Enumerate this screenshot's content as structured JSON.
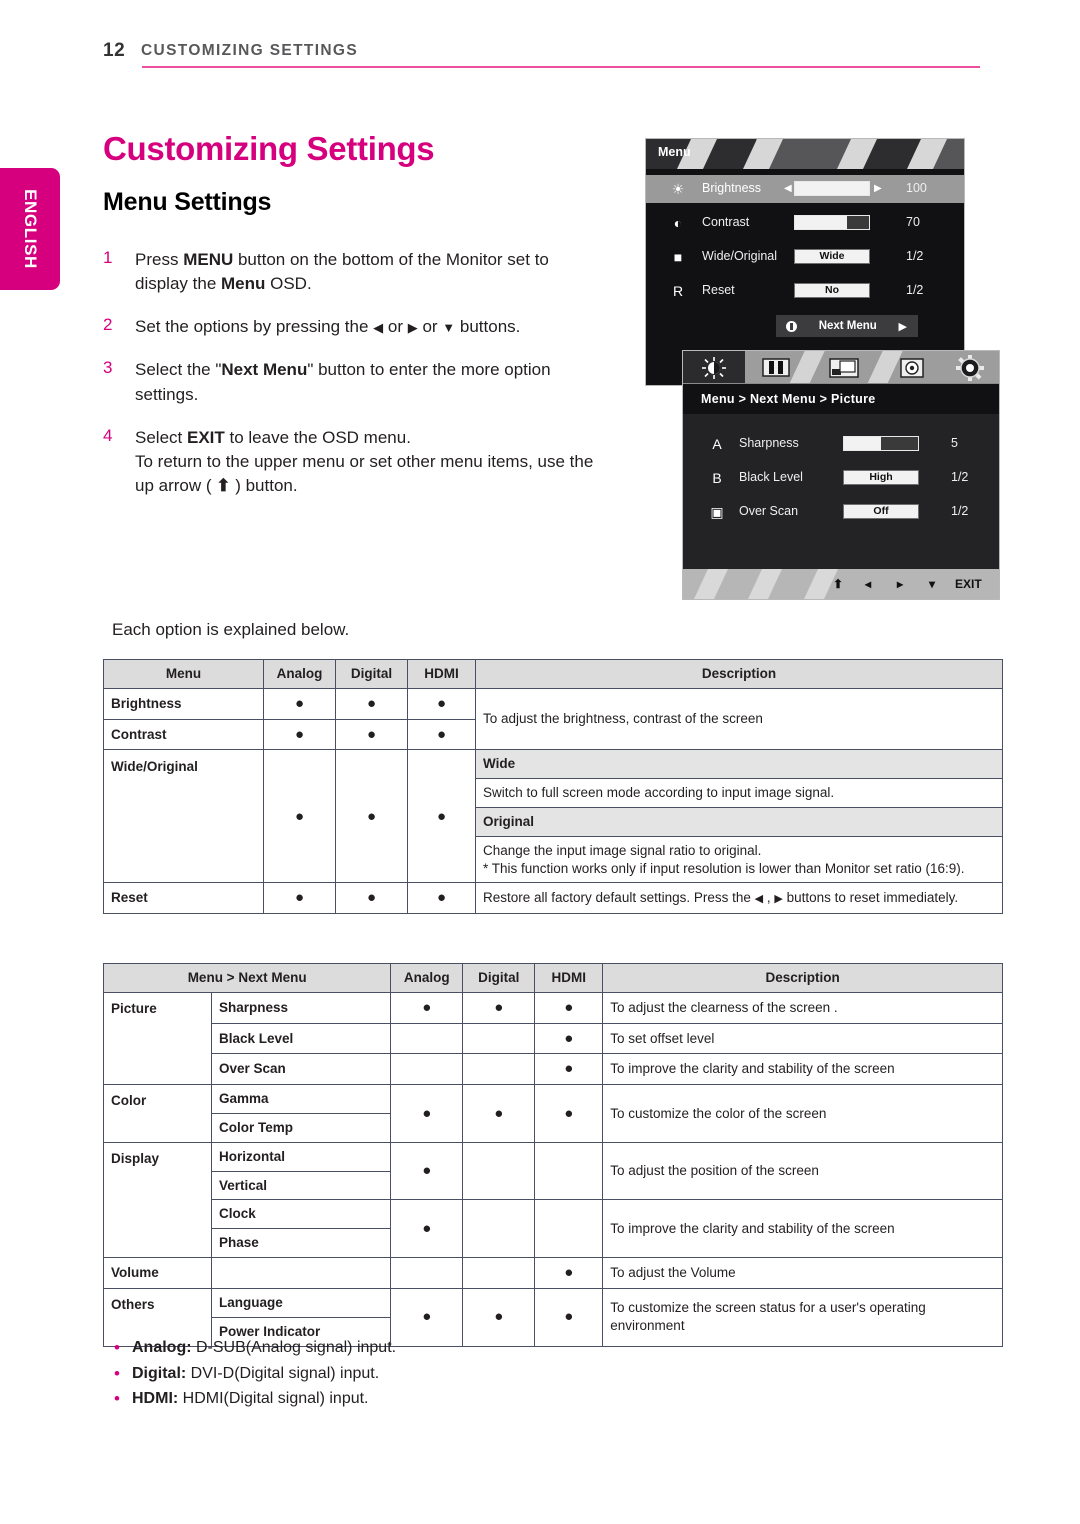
{
  "header": {
    "page_number": "12",
    "section_title": "CUSTOMIZING SETTINGS",
    "rule_color": "#ec4f9c"
  },
  "language_tab": {
    "label": "ENGLISH",
    "color": "#d6007f"
  },
  "titles": {
    "h1": "Customizing Settings",
    "h1_color": "#d6007f",
    "h2": "Menu Settings"
  },
  "steps": [
    {
      "num": "1",
      "html": "Press <b>MENU</b> button on the bottom of the Monitor set to display the <b>Menu</b> OSD."
    },
    {
      "num": "2",
      "html": "Set the options by pressing the <span class=\"arrow-g\">◀</span> or <span class=\"arrow-g\">▶</span> or <span class=\"arrow-g\">▼</span> buttons."
    },
    {
      "num": "3",
      "html": "Select the \"<b>Next Menu</b>\" button to enter the more option settings."
    },
    {
      "num": "4",
      "html": "Select <b>EXIT</b> to leave the OSD menu.<br>To return to the upper menu or set other menu items, use the up arrow ( <b>⬆</b> ) button."
    }
  ],
  "each_option_note": "Each option is explained below.",
  "osd_menu": {
    "title": "Menu",
    "rows": [
      {
        "icon": "brightness-sun-icon",
        "glyph": "☀",
        "label": "Brightness",
        "widget": "slider",
        "fill_pct": 100,
        "value": "100",
        "selected": true,
        "carets": true
      },
      {
        "icon": "contrast-icon",
        "glyph": "◐",
        "label": "Contrast",
        "widget": "slider",
        "fill_pct": 70,
        "value": "70",
        "selected": false,
        "carets": false
      },
      {
        "icon": "wide-original-icon",
        "glyph": "■",
        "label": "Wide/Original",
        "widget": "option",
        "option_value": "Wide",
        "value": "1/2",
        "selected": false,
        "carets": false
      },
      {
        "icon": "reset-icon",
        "glyph": "R",
        "label": "Reset",
        "widget": "option",
        "option_value": "No",
        "value": "1/2",
        "selected": false,
        "carets": false
      }
    ],
    "next_menu_label": "Next Menu"
  },
  "osd_picture": {
    "tabs": [
      {
        "name": "tab-picture",
        "active": true
      },
      {
        "name": "tab-color",
        "active": false
      },
      {
        "name": "tab-display",
        "active": false
      },
      {
        "name": "tab-volume",
        "active": false
      },
      {
        "name": "tab-others",
        "active": false
      }
    ],
    "breadcrumb": "Menu  >  Next Menu  >  Picture",
    "rows": [
      {
        "icon": "sharpness-icon",
        "glyph": "A",
        "label": "Sharpness",
        "widget": "slider",
        "fill_pct": 50,
        "value": "5"
      },
      {
        "icon": "black-level-icon",
        "glyph": "B",
        "label": "Black Level",
        "widget": "option",
        "option_value": "High",
        "value": "1/2"
      },
      {
        "icon": "over-scan-icon",
        "glyph": "▣",
        "label": "Over Scan",
        "widget": "option",
        "option_value": "Off",
        "value": "1/2"
      }
    ],
    "footer": {
      "up": "⬆",
      "left": "◂",
      "right": "▸",
      "down": "▾",
      "exit": "EXIT"
    }
  },
  "table1": {
    "headers": [
      "Menu",
      "Analog",
      "Digital",
      "HDMI",
      "Description"
    ],
    "rows": {
      "brightness": {
        "name": "Brightness",
        "analog": "●",
        "digital": "●",
        "hdmi": "●"
      },
      "contrast": {
        "name": "Contrast",
        "analog": "●",
        "digital": "●",
        "hdmi": "●"
      },
      "brightness_contrast_desc": "To adjust the brightness, contrast of the screen",
      "wide_original": {
        "name": "Wide/Original",
        "analog": "●",
        "digital": "●",
        "hdmi": "●"
      },
      "wide_label": "Wide",
      "wide_desc": "Switch to full screen mode according to input image signal.",
      "original_label": "Original",
      "original_desc": "Change the input image signal ratio to original.\n* This function works only if input resolution is lower than Monitor set ratio (16:9).",
      "reset": {
        "name": "Reset",
        "analog": "●",
        "digital": "●",
        "hdmi": "●"
      },
      "reset_desc_pre": "Restore all factory default settings. Press the ",
      "reset_desc_mid": " , ",
      "reset_desc_post": " buttons to reset immediately."
    }
  },
  "table2": {
    "headers": [
      "Menu > Next Menu",
      "Analog",
      "Digital",
      "HDMI",
      "Description"
    ],
    "groups": [
      {
        "group": "Picture",
        "items": [
          {
            "name": "Sharpness",
            "analog": "●",
            "digital": "●",
            "hdmi": "●",
            "desc": "To adjust the clearness of the screen ."
          },
          {
            "name": "Black Level",
            "analog": "",
            "digital": "",
            "hdmi": "●",
            "desc": "To set offset level"
          },
          {
            "name": "Over Scan",
            "analog": "",
            "digital": "",
            "hdmi": "●",
            "desc": "To improve the clarity and stability of the screen"
          }
        ]
      },
      {
        "group": "Color",
        "items": [
          {
            "name": "Gamma"
          },
          {
            "name": "Color Temp"
          }
        ],
        "analog": "●",
        "digital": "●",
        "hdmi": "●",
        "desc": "To customize the color of the screen"
      },
      {
        "group": "Display",
        "subgroups": [
          {
            "items": [
              {
                "name": "Horizontal"
              },
              {
                "name": "Vertical"
              }
            ],
            "analog": "●",
            "digital": "",
            "hdmi": "",
            "desc": "To adjust the position of the screen"
          },
          {
            "items": [
              {
                "name": "Clock"
              },
              {
                "name": "Phase"
              }
            ],
            "analog": "●",
            "digital": "",
            "hdmi": "",
            "desc": "To improve the clarity and stability of the screen"
          }
        ]
      },
      {
        "group": "Volume",
        "items": [],
        "analog": "",
        "digital": "",
        "hdmi": "●",
        "desc": "To adjust the Volume"
      },
      {
        "group": "Others",
        "items": [
          {
            "name": "Language"
          },
          {
            "name": "Power Indicator"
          }
        ],
        "analog": "●",
        "digital": "●",
        "hdmi": "●",
        "desc": "To customize the screen status for a user's operating environment"
      }
    ]
  },
  "footnotes": [
    {
      "term": "Analog:",
      "text": " D-SUB(Analog signal) input."
    },
    {
      "term": "Digital:",
      "text": " DVI-D(Digital signal) input."
    },
    {
      "term": "HDMI:",
      "text": " HDMI(Digital signal) input."
    }
  ]
}
